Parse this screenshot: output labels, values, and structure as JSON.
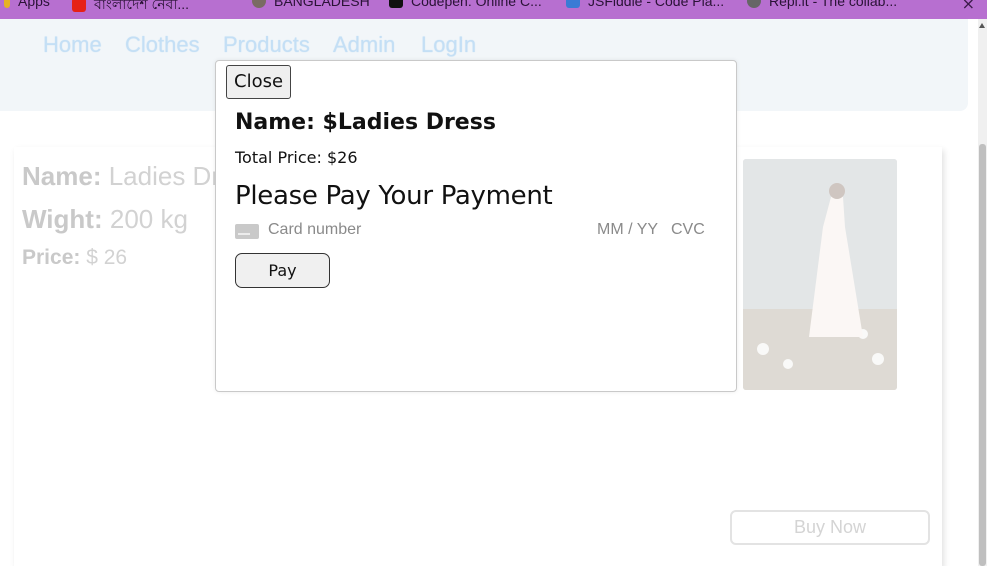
{
  "browser": {
    "bookmarks": [
      {
        "label": "Apps",
        "icon": "apps-grid-icon",
        "color": "#e6b325"
      },
      {
        "label": "বাংলাদেশ নেবী...",
        "icon": "youtube-icon",
        "color": "#e62117"
      },
      {
        "label": "BANGLADESH",
        "icon": "globe-icon",
        "color": "#7a6b63"
      },
      {
        "label": "Codepen: Online C...",
        "icon": "codepen-icon",
        "color": "#111111"
      },
      {
        "label": "JSFiddle - Code Pla...",
        "icon": "jsfiddle-icon",
        "color": "#3a7bd5"
      },
      {
        "label": "Repl.it - The collab...",
        "icon": "replit-icon",
        "color": "#666666"
      }
    ],
    "close_glyph": "×"
  },
  "nav": {
    "links": [
      "Home",
      "Clothes",
      "Products",
      "Admin",
      "LogIn"
    ]
  },
  "product": {
    "name_label": "Name:",
    "name_value": "Ladies Dress",
    "weight_label": "Wight:",
    "weight_value": "200 kg",
    "price_label": "Price:",
    "price_value": "$ 26",
    "buy_now_label": "Buy Now"
  },
  "modal": {
    "close_label": "Close",
    "name_text": "Name: $Ladies Dress",
    "total_price_text": "Total Price: $26",
    "heading": "Please Pay Your Payment",
    "card_number_placeholder": "Card number",
    "expiry_placeholder": "MM / YY",
    "cvc_placeholder": "CVC",
    "pay_label": "Pay"
  },
  "colors": {
    "bookmark_bar": "#b76fd0",
    "nav_link": "#c4dff5",
    "navbar_bg": "#f2f6f9"
  }
}
